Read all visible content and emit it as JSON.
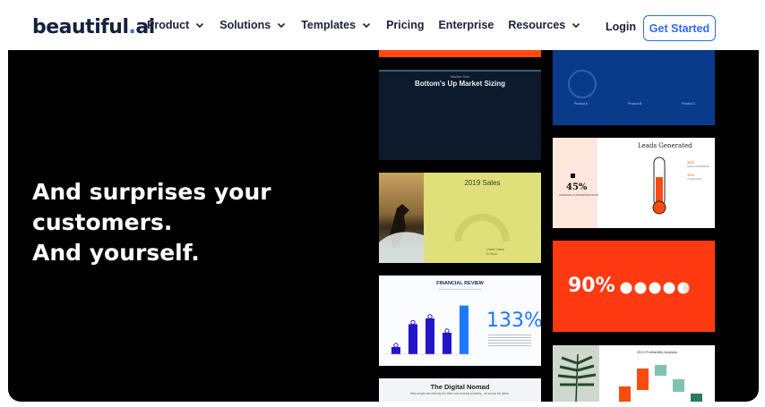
{
  "nav": {
    "logo_main": "beautiful",
    "logo_dot": ".",
    "logo_suffix": "ai",
    "items": [
      {
        "label": "Product",
        "dropdown": true
      },
      {
        "label": "Solutions",
        "dropdown": true
      },
      {
        "label": "Templates",
        "dropdown": true
      },
      {
        "label": "Pricing",
        "dropdown": false
      },
      {
        "label": "Enterprise",
        "dropdown": false
      },
      {
        "label": "Resources",
        "dropdown": true
      }
    ],
    "login": "Login",
    "cta": "Get Started"
  },
  "hero": {
    "lines": [
      "And surprises your",
      "customers.",
      "And yourself."
    ]
  },
  "slides": {
    "market": {
      "kicker": "Market Size",
      "title": "Bottom's Up Market Sizing"
    },
    "products": {
      "labels": [
        "Product A",
        "Product B",
        "Product C"
      ]
    },
    "leads": {
      "title": "Leads Generated",
      "stat": "45%",
      "stat_caption": "AVERAGE CONVERSION RATE",
      "ann_1": "45%",
      "ann_1_caption": "LEAD CONVERSION",
      "ann_2": "33%",
      "ann_2_caption": "CLOSE RATE"
    },
    "sales": {
      "title": "2019 Sales",
      "legend": [
        "Online Sales",
        "In Store"
      ]
    },
    "financial": {
      "title": "FINANCIAL REVIEW",
      "stat": "133%",
      "bar_values": [
        10,
        42,
        50,
        30,
        68
      ]
    },
    "big": {
      "value": "90%"
    },
    "nomad": {
      "title": "The Digital Nomad",
      "subtitle": "Why people are ditching the office and working remotely... all across the globe."
    },
    "profit": {
      "title": "2019 Profitability Analysis"
    }
  },
  "colors": {
    "accent": "#2f6bff",
    "orange": "#ff4a10",
    "navy": "#0a3a8a",
    "yellow": "#dfe07a"
  }
}
